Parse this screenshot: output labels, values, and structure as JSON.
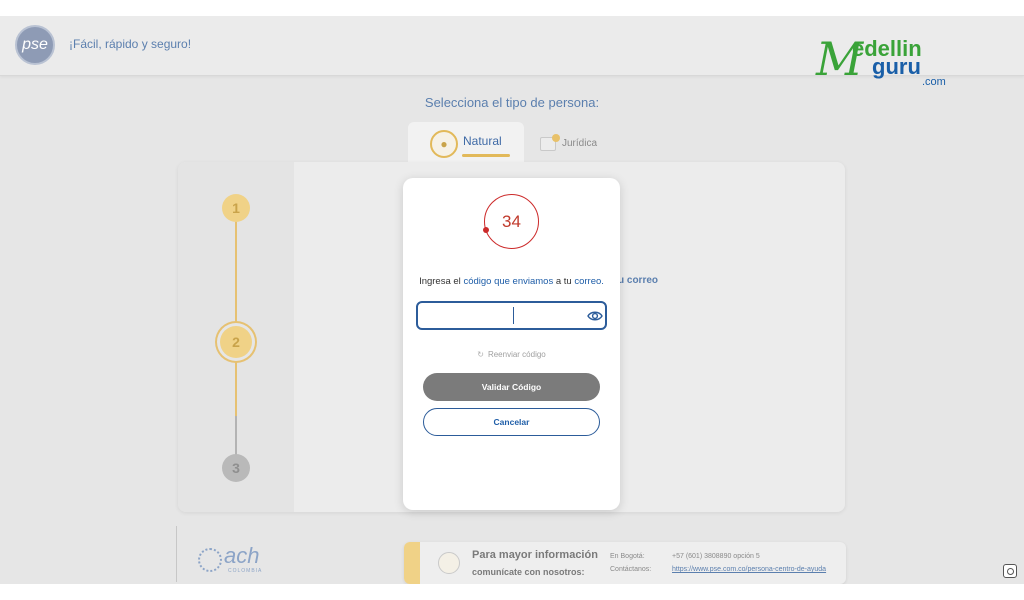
{
  "header": {
    "logo_text": "pse",
    "tagline": "¡Fácil, rápido y seguro!",
    "watermark": {
      "m": "M",
      "edellin": "edellin",
      "guru": "guru",
      "com": ".com"
    }
  },
  "person_type": {
    "title": "Selecciona el tipo de persona:",
    "tabs": [
      {
        "label": "Natural",
        "active": true
      },
      {
        "label": "Jurídica",
        "active": false
      }
    ]
  },
  "stepper": {
    "steps": [
      "1",
      "2",
      "3"
    ],
    "current": 2
  },
  "background_link": "u correo",
  "modal": {
    "timer": "34",
    "instruction_prefix": "Ingresa el ",
    "instruction_link": "código que enviamos",
    "instruction_mid": " a tu ",
    "instruction_end": "correo.",
    "code_value": "",
    "resend_label": "Reenviar código",
    "validate_label": "Validar Código",
    "cancel_label": "Cancelar"
  },
  "footer": {
    "ach_logo": "ach",
    "ach_sub": "COLOMBIA",
    "info_title": "Para mayor información",
    "info_sub": "comunícate con nosotros:",
    "contact_label_1": "En Bogotá:",
    "contact_value_1": "+57 (601) 3808890 opción 5",
    "contact_label_2": "Contáctanos:",
    "contact_value_2": "https://www.pse.com.co/persona-centro-de-ayuda"
  },
  "colors": {
    "primary_blue": "#1f5ea8",
    "accent_gold": "#e6c172",
    "timer_red": "#cc2a2a",
    "button_gray": "#7b7b7b"
  }
}
